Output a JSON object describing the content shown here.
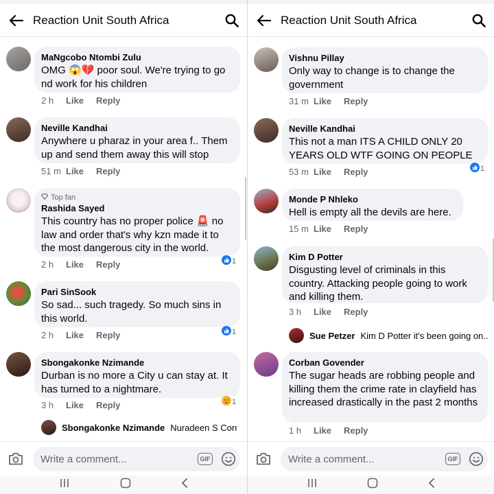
{
  "header": {
    "title": "Reaction Unit South Africa"
  },
  "composer": {
    "placeholder": "Write a comment...",
    "gif_label": "GIF"
  },
  "actions": {
    "like": "Like",
    "reply": "Reply"
  },
  "colors": {
    "reaction_like_blue": "#1877f2",
    "bubble": "#f0f2f5",
    "meta_grey": "#65676b"
  },
  "left_comments": [
    {
      "name": "MaNgcobo Ntombi Zulu",
      "text_a": "OMG ",
      "text_b": " poor soul. We're trying to go nd work for his children",
      "time": "2 h",
      "emojis": [
        "scream-emoji",
        "broken-heart-emoji"
      ]
    },
    {
      "name": "Neville Kandhai",
      "text": "Anywhere u pharaz in your area f.. Them up and send them away this will stop",
      "time": "51 m"
    },
    {
      "badge": "Top fan",
      "name": "Rashida Sayed",
      "text_a": "This country has no proper police ",
      "text_b": " no law and order that's why kzn made it to the most dangerous city in the world.",
      "time": "2 h",
      "reaction": {
        "type": "like",
        "count": "1"
      },
      "emojis": [
        "siren-emoji"
      ]
    },
    {
      "name": "Pari SinSook",
      "text": "So sad... such tragedy. So much sins in this world.",
      "time": "2 h",
      "reaction": {
        "type": "like",
        "count": "1"
      }
    },
    {
      "name": "Sbongakonke Nzimande",
      "text": "Durban is no more a City u can stay at. It has turned to a nightmare.",
      "time": "3 h",
      "reaction": {
        "type": "sad",
        "count": "1"
      },
      "reply": {
        "name": "Sbongakonke Nzimande",
        "text": "Nuradeen S Corr..."
      }
    }
  ],
  "right_comments": [
    {
      "name": "Vishnu Pillay",
      "text": "Only way to change is to change the government",
      "time": "31 m"
    },
    {
      "name": "Neville Kandhai",
      "text": "This not a man ITS A CHILD ONLY 20 YEARS OLD WTF GOING ON PEOPLE",
      "time": "53 m",
      "reaction": {
        "type": "like",
        "count": "1"
      }
    },
    {
      "name": "Monde P Nhleko",
      "text": "Hell is empty all the devils are here.",
      "time": "15 m"
    },
    {
      "name": "Kim D Potter",
      "text": "Disgusting level of criminals in this country. Attacking people going to work and killing them.",
      "time": "3 h",
      "reply": {
        "name": "Sue Petzer",
        "text": "Kim D Potter it's been going on..."
      }
    },
    {
      "name": "Corban Govender",
      "text": "The sugar heads are robbing people and killing them the crime rate in clayfield has increased drastically in the past 2 months",
      "time": "1 h"
    }
  ]
}
